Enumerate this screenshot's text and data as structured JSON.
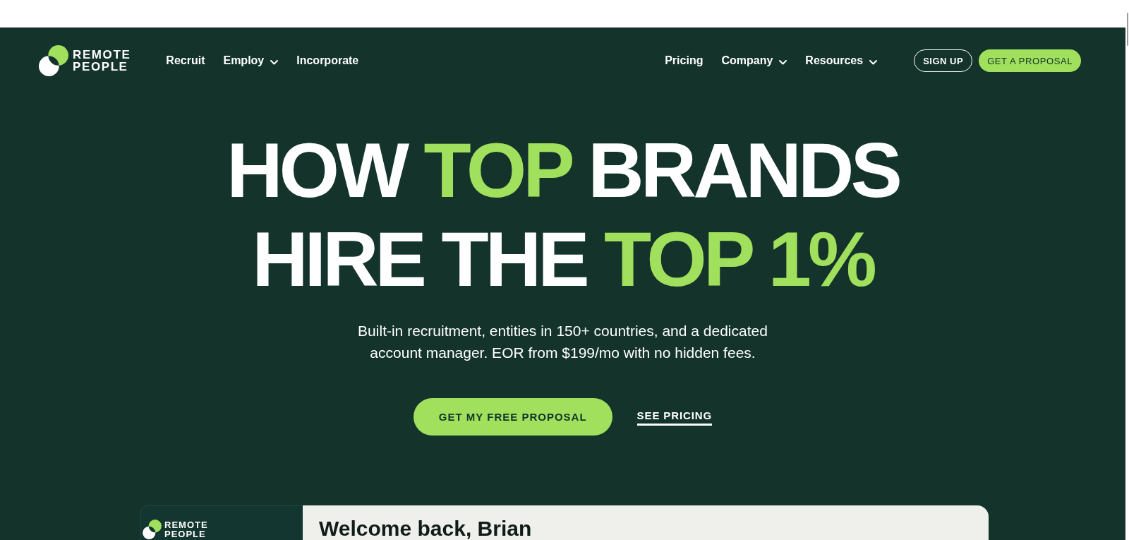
{
  "logo": {
    "text": "REMOTE PEOPLE"
  },
  "nav": {
    "left_items": [
      {
        "label": "Recruit",
        "has_menu": false
      },
      {
        "label": "Employ",
        "has_menu": true
      },
      {
        "label": "Incorporate",
        "has_menu": false
      }
    ],
    "right_items": [
      {
        "label": "Pricing",
        "has_menu": false
      },
      {
        "label": "Company",
        "has_menu": true
      },
      {
        "label": "Resources",
        "has_menu": true
      }
    ],
    "buttons": [
      {
        "label": "SIGN UP",
        "kind": "outline"
      },
      {
        "label": "GET A PROPOSAL",
        "kind": "filled"
      }
    ]
  },
  "hero": {
    "headline": [
      [
        {
          "text": "HOW ",
          "highlight": false
        },
        {
          "text": "TOP",
          "highlight": true
        },
        {
          "text": " BRANDS",
          "highlight": false
        }
      ],
      [
        {
          "text": "HIRE THE ",
          "highlight": false
        },
        {
          "text": "TOP 1%",
          "highlight": true
        }
      ]
    ],
    "subtitle": "Built-in recruitment, entities in 150+ countries, and a dedicated account manager. EOR from $199/mo with no hidden fees.",
    "actions": [
      {
        "label": "GET MY FREE PROPOSAL",
        "kind": "button"
      },
      {
        "label": "SEE PRICING",
        "kind": "link"
      }
    ]
  },
  "preview": {
    "logo": {
      "text": "REMOTE PEOPLE"
    },
    "heading": "Welcome back, Brian"
  }
}
